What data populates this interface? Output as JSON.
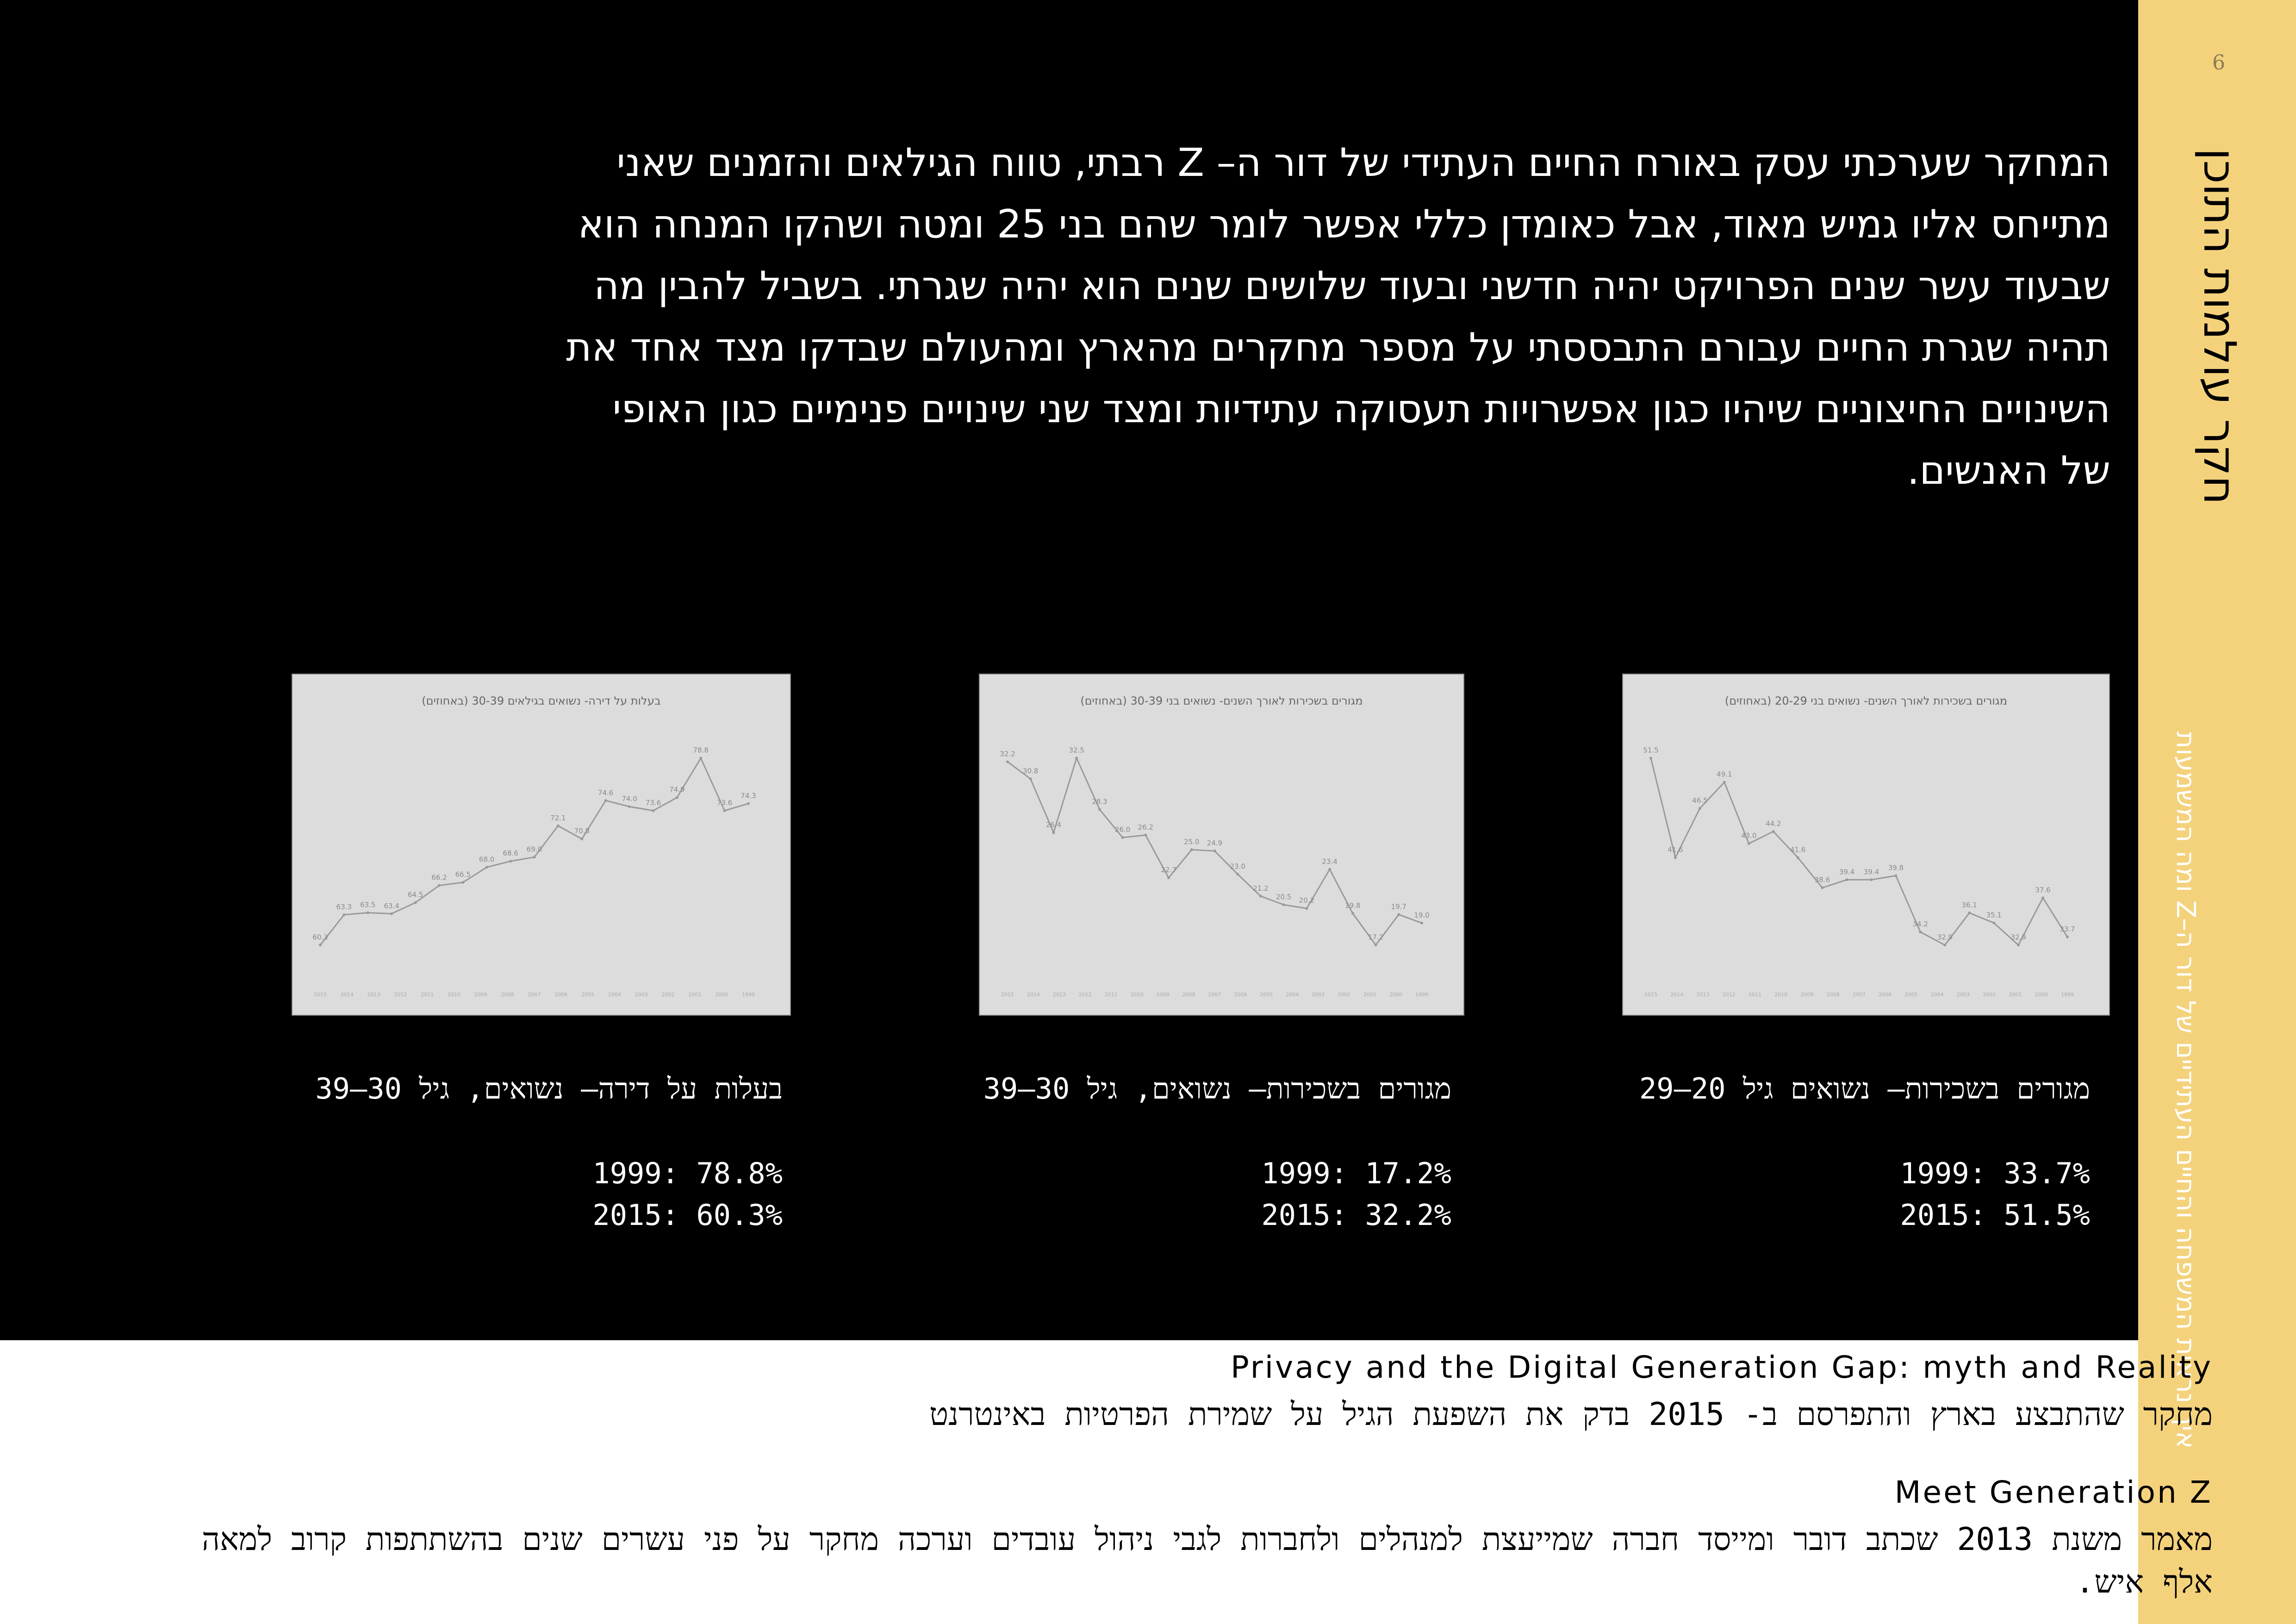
{
  "page_number": "6",
  "sidebar": {
    "title": "חקר עולמות התוכן",
    "subtitle": "איך נראית המשפחה והחיים העתידיים של דור ה–Z ומה המשמעות"
  },
  "intro_text": "המחקר שערכתי עסק באורח החיים העתידי של דור ה– Z רבתי, טווח הגילאים והזמנים שאני מתייחס אליו גמיש מאוד, אבל כאומדן כללי אפשר לומר שהם בני 25 ומטה ושהקו המנחה הוא שבעוד עשר שנים הפרויקט יהיה חדשני ובעוד שלושים שנים הוא יהיה שגרתי. בשביל להבין מה תהיה שגרת החיים עבורם התבססתי על מספר מחקרים מהארץ ומהעולם שבדקו מצד אחד את השינויים החיצוניים שיהיו כגון אפשרויות תעסוקה עתידיות ומצד שני שינויים פנימיים כגון האופי של האנשים.",
  "cards": [
    {
      "chart_title": "מגורים בשכירות לאורך השנים- נשואים בני 20-29 (באחוזים)",
      "caption": "מגורים בשכירות– נשואים גיל 20–29",
      "stat_1999": "1999: 33.7%",
      "stat_2015": "2015: 51.5%"
    },
    {
      "chart_title": "מגורים בשכירות לאורך השנים- נשואים בני 30-39 (באחוזים)",
      "caption": "מגורים בשכירות– נשואים, גיל 30–39",
      "stat_1999": "1999: 17.2%",
      "stat_2015": "2015: 32.2%"
    },
    {
      "chart_title": "בעלות על דירה- נשואים בגילאים 30-39 (באחוזים)",
      "caption": "בעלות על דירה– נשואים, גיל 30–39",
      "stat_1999": "1999: 78.8%",
      "stat_2015": "2015: 60.3%"
    }
  ],
  "chart_data": [
    {
      "type": "line",
      "title": "מגורים בשכירות לאורך השנים- נשואים בני 20-29 (באחוזים)",
      "x": [
        2015,
        2014,
        2013,
        2012,
        2011,
        2010,
        2009,
        2008,
        2007,
        2006,
        2005,
        2004,
        2003,
        2002,
        2001,
        2000,
        1999
      ],
      "values": [
        51.5,
        41.6,
        46.5,
        49.1,
        43.0,
        44.2,
        41.6,
        38.6,
        39.4,
        39.4,
        39.8,
        34.2,
        32.9,
        36.1,
        35.1,
        32.9,
        37.6,
        33.7
      ],
      "series": [
        {
          "values": [
            51.5,
            41.6,
            46.5,
            49.1,
            43.0,
            44.2,
            41.6,
            38.6,
            39.4,
            39.4,
            39.8,
            34.2,
            32.9,
            36.1,
            35.1,
            32.9,
            37.6,
            33.7
          ]
        }
      ]
    },
    {
      "type": "line",
      "title": "מגורים בשכירות לאורך השנים- נשואים בני 30-39 (באחוזים)",
      "x": [
        2015,
        2014,
        2013,
        2012,
        2011,
        2010,
        2009,
        2008,
        2007,
        2006,
        2005,
        2004,
        2003,
        2002,
        2001,
        2000,
        1999
      ],
      "series": [
        {
          "values": [
            32.2,
            30.8,
            26.4,
            32.5,
            28.3,
            26.0,
            26.2,
            22.7,
            25.0,
            24.9,
            23.0,
            21.2,
            20.5,
            20.2,
            23.4,
            19.8,
            17.2,
            19.7,
            19.0
          ]
        }
      ]
    },
    {
      "type": "line",
      "title": "בעלות על דירה- נשואים בגילאים 30-39 (באחוזים)",
      "x": [
        2015,
        2014,
        2013,
        2012,
        2011,
        2010,
        2009,
        2008,
        2007,
        2006,
        2005,
        2004,
        2003,
        2002,
        2001,
        2000,
        1999
      ],
      "series": [
        {
          "values": [
            60.3,
            63.3,
            63.5,
            63.4,
            64.5,
            66.2,
            66.5,
            68.0,
            68.6,
            69.0,
            72.1,
            70.8,
            74.6,
            74.0,
            73.6,
            74.9,
            78.8,
            73.6,
            74.3
          ]
        }
      ]
    }
  ],
  "references": [
    {
      "english_title": "Privacy and the Digital Generation Gap: myth and Reality",
      "hebrew_text": "מחקר שהתבצע בארץ והתפרסם ב- 2015 בדק את השפעת הגיל על שמירת הפרטיות באינטרנט"
    },
    {
      "english_title": "Meet Generation Z",
      "hebrew_text": "מאמר משנת 2013 שכתב דובר ומייסד חברה שמייעצת למנהלים ולחברות לגבי ניהול עובדים וערכה מחקר על פני עשרים שנים בהשתתפות קרוב למאה אלף איש."
    }
  ]
}
